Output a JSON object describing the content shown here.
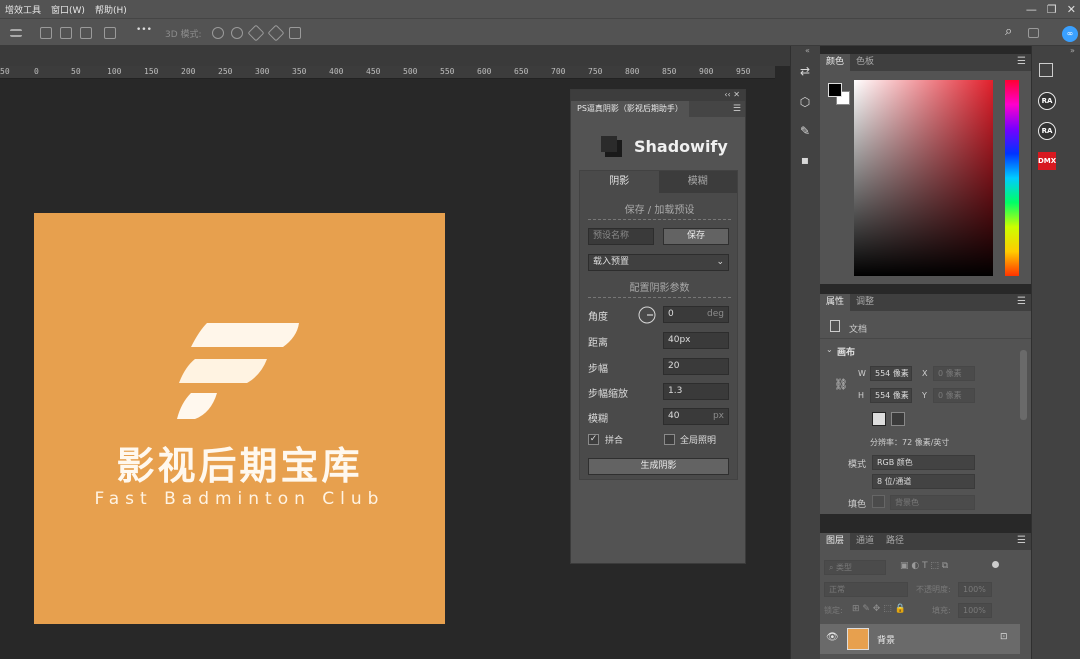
{
  "menubar": {
    "items": [
      "增效工具",
      "窗口(W)",
      "帮助(H)"
    ],
    "window_controls": [
      "—",
      "❐",
      "✕"
    ]
  },
  "optbar": {
    "mode_label": "3D 模式:",
    "more": "•••"
  },
  "ruler": {
    "ticks": [
      "50",
      "0",
      "50",
      "100",
      "150",
      "200",
      "250",
      "300",
      "350",
      "400",
      "450",
      "500",
      "550",
      "600",
      "650",
      "700",
      "750",
      "800",
      "850",
      "900",
      "950"
    ]
  },
  "artwork": {
    "title_cn": "影视后期宝库",
    "subtitle_en": "Fast Badminton Club",
    "bg_color": "#e7a04e"
  },
  "plugin": {
    "window_tab": "PS逼真阴影（影视后期助手）",
    "product_name": "Shadowify",
    "tabs": [
      "阴影",
      "模糊"
    ],
    "preset_section": "保存 / 加载预设",
    "preset_name_placeholder": "预设名称",
    "save_button": "保存",
    "load_preset": "载入预置",
    "config_section": "配置阴影参数",
    "params": {
      "angle_label": "角度",
      "angle_value": "0",
      "angle_unit": "deg",
      "distance_label": "距离",
      "distance_value": "40px",
      "steps_label": "步幅",
      "steps_value": "20",
      "step_scale_label": "步幅缩放",
      "step_scale_value": "1.3",
      "blur_label": "模糊",
      "blur_value": "40",
      "blur_unit": "px"
    },
    "checkbox_merge": "拼合",
    "checkbox_merge_checked": true,
    "checkbox_global": "全局照明",
    "checkbox_global_checked": false,
    "generate_button": "生成阴影"
  },
  "color_panel": {
    "tabs": [
      "颜色",
      "色板"
    ]
  },
  "properties_panel": {
    "tabs": [
      "属性",
      "调整"
    ],
    "doc_label": "文档",
    "canvas_section": "画布",
    "w_label": "W",
    "w_value": "554 像素",
    "x_label": "X",
    "x_value": "0 像素",
    "h_label": "H",
    "h_value": "554 像素",
    "y_label": "Y",
    "y_value": "0 像素",
    "resolution": "分辨率：72 像素/英寸",
    "mode_label": "模式",
    "mode_value": "RGB 颜色",
    "depth_value": "8 位/通道",
    "fill_label": "填色",
    "fill_value": "背景色"
  },
  "layers_panel": {
    "tabs": [
      "图层",
      "通道",
      "路径"
    ],
    "filter_placeholder": "类型",
    "blend_mode": "正常",
    "opacity_label": "不透明度:",
    "opacity_value": "100%",
    "lock_label": "锁定:",
    "fill_label": "填充:",
    "fill_value": "100%",
    "layer_name": "背景"
  }
}
